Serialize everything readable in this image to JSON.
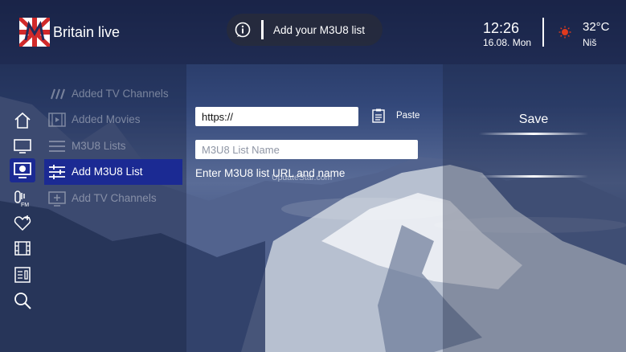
{
  "header": {
    "app_title": "Britain live",
    "notice": "Add your M3U8 list",
    "time": "12:26",
    "date": "16.08. Mon",
    "temperature": "32°C",
    "city": "Niš"
  },
  "rail": {
    "items": [
      {
        "name": "home-icon",
        "active": false
      },
      {
        "name": "tv-icon",
        "active": false
      },
      {
        "name": "playlist-icon",
        "active": true
      },
      {
        "name": "radio-fm-icon",
        "active": false
      },
      {
        "name": "favorites-icon",
        "active": false
      },
      {
        "name": "movies-icon",
        "active": false
      },
      {
        "name": "epg-icon",
        "active": false
      },
      {
        "name": "search-icon",
        "active": false
      }
    ]
  },
  "menu": {
    "items": [
      {
        "label": "Added TV Channels",
        "icon": "slashes-icon",
        "active": false
      },
      {
        "label": "Added Movies",
        "icon": "film-icon",
        "active": false
      },
      {
        "label": "M3U8 Lists",
        "icon": "list-icon",
        "active": false
      },
      {
        "label": "Add M3U8 List",
        "icon": "add-list-icon",
        "active": true
      },
      {
        "label": "Add TV Channels",
        "icon": "add-tv-icon",
        "active": false
      }
    ]
  },
  "form": {
    "url_value": "https://",
    "name_placeholder": "M3U8 List Name",
    "paste_label": "Paste",
    "hint": "Enter M3U8 list URL and name",
    "watermark": "UpdateStar.com"
  },
  "save_label": "Save",
  "colors": {
    "active_menu": "#1b2a93",
    "notice_bg": "#282c3a",
    "sun": "#e03a1e"
  }
}
